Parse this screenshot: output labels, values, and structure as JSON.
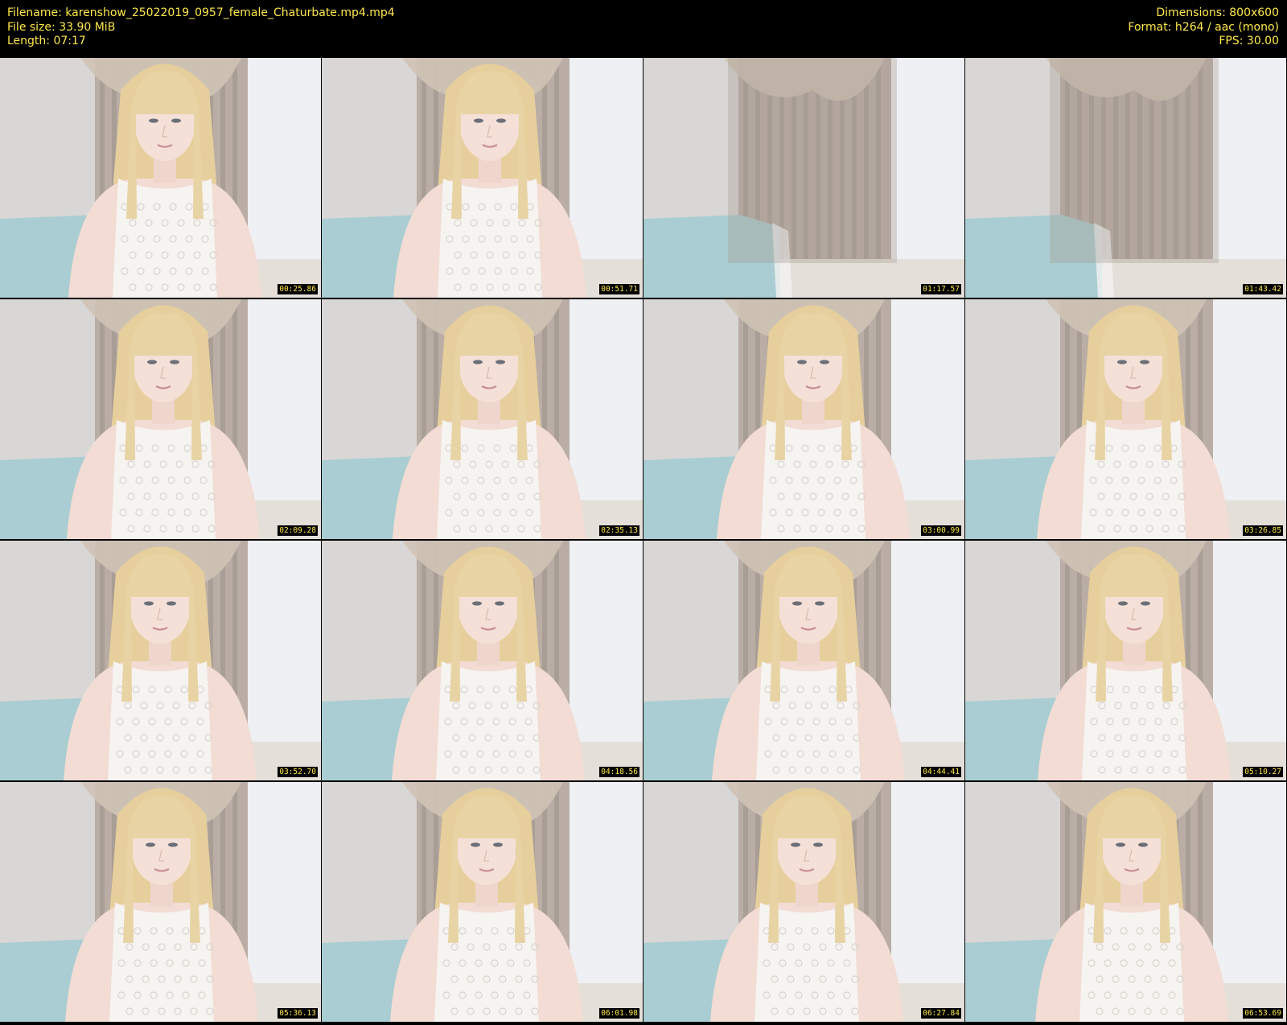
{
  "header": {
    "filename": "Filename: karenshow_25022019_0957_female_Chaturbate.mp4.mp4",
    "filesize": "File size: 33.90 MiB",
    "length": "Length: 07:17",
    "dimensions": "Dimensions: 800x600",
    "format": "Format: h264 / aac (mono)",
    "fps": "FPS: 30.00"
  },
  "colors": {
    "header_text": "#ffe84a",
    "background": "#000000",
    "timestamp_text": "#ffe84a"
  },
  "thumbnails": [
    {
      "timestamp": "00:25.86",
      "subject": "person"
    },
    {
      "timestamp": "00:51.71",
      "subject": "person"
    },
    {
      "timestamp": "01:17.57",
      "subject": "empty-room"
    },
    {
      "timestamp": "01:43.42",
      "subject": "empty-room"
    },
    {
      "timestamp": "02:09.28",
      "subject": "person"
    },
    {
      "timestamp": "02:35.13",
      "subject": "person"
    },
    {
      "timestamp": "03:00.99",
      "subject": "person"
    },
    {
      "timestamp": "03:26.85",
      "subject": "person"
    },
    {
      "timestamp": "03:52.70",
      "subject": "person"
    },
    {
      "timestamp": "04:18.56",
      "subject": "person"
    },
    {
      "timestamp": "04:44.41",
      "subject": "person"
    },
    {
      "timestamp": "05:10.27",
      "subject": "person"
    },
    {
      "timestamp": "05:36.13",
      "subject": "person"
    },
    {
      "timestamp": "06:01.98",
      "subject": "person"
    },
    {
      "timestamp": "06:27.84",
      "subject": "person"
    },
    {
      "timestamp": "06:53.69",
      "subject": "person"
    }
  ]
}
